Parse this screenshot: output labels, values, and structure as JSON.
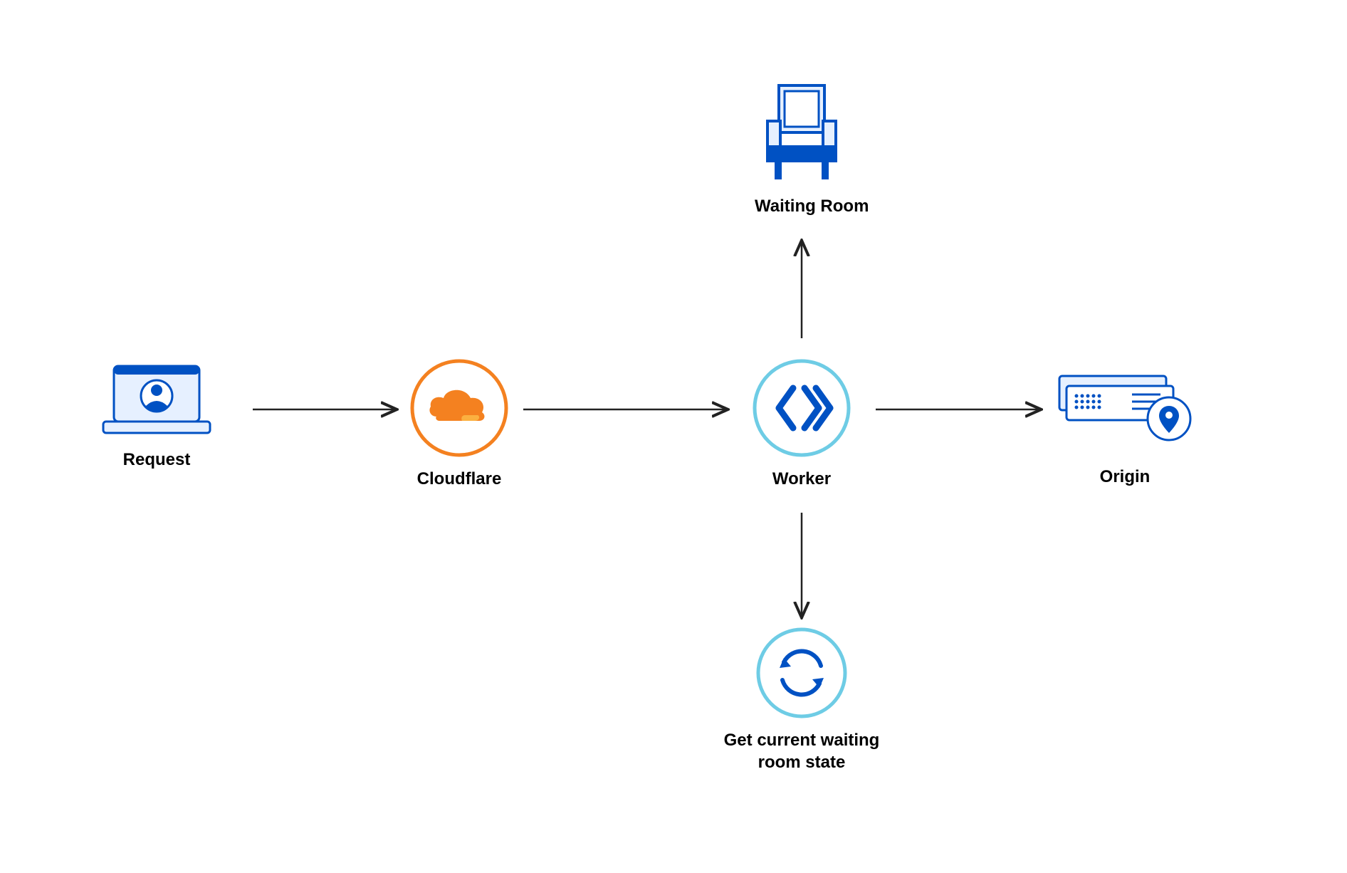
{
  "diagram": {
    "nodes": {
      "request": {
        "label": "Request"
      },
      "cloudflare": {
        "label": "Cloudflare"
      },
      "worker": {
        "label": "Worker"
      },
      "waiting_room": {
        "label": "Waiting Room"
      },
      "origin": {
        "label": "Origin"
      },
      "state": {
        "label": "Get current waiting room state"
      }
    },
    "colors": {
      "orange": "#f48120",
      "blue": "#0051c3",
      "teal": "#6ecce5",
      "lightblue": "#e6f0ff",
      "dark": "#222222"
    }
  }
}
